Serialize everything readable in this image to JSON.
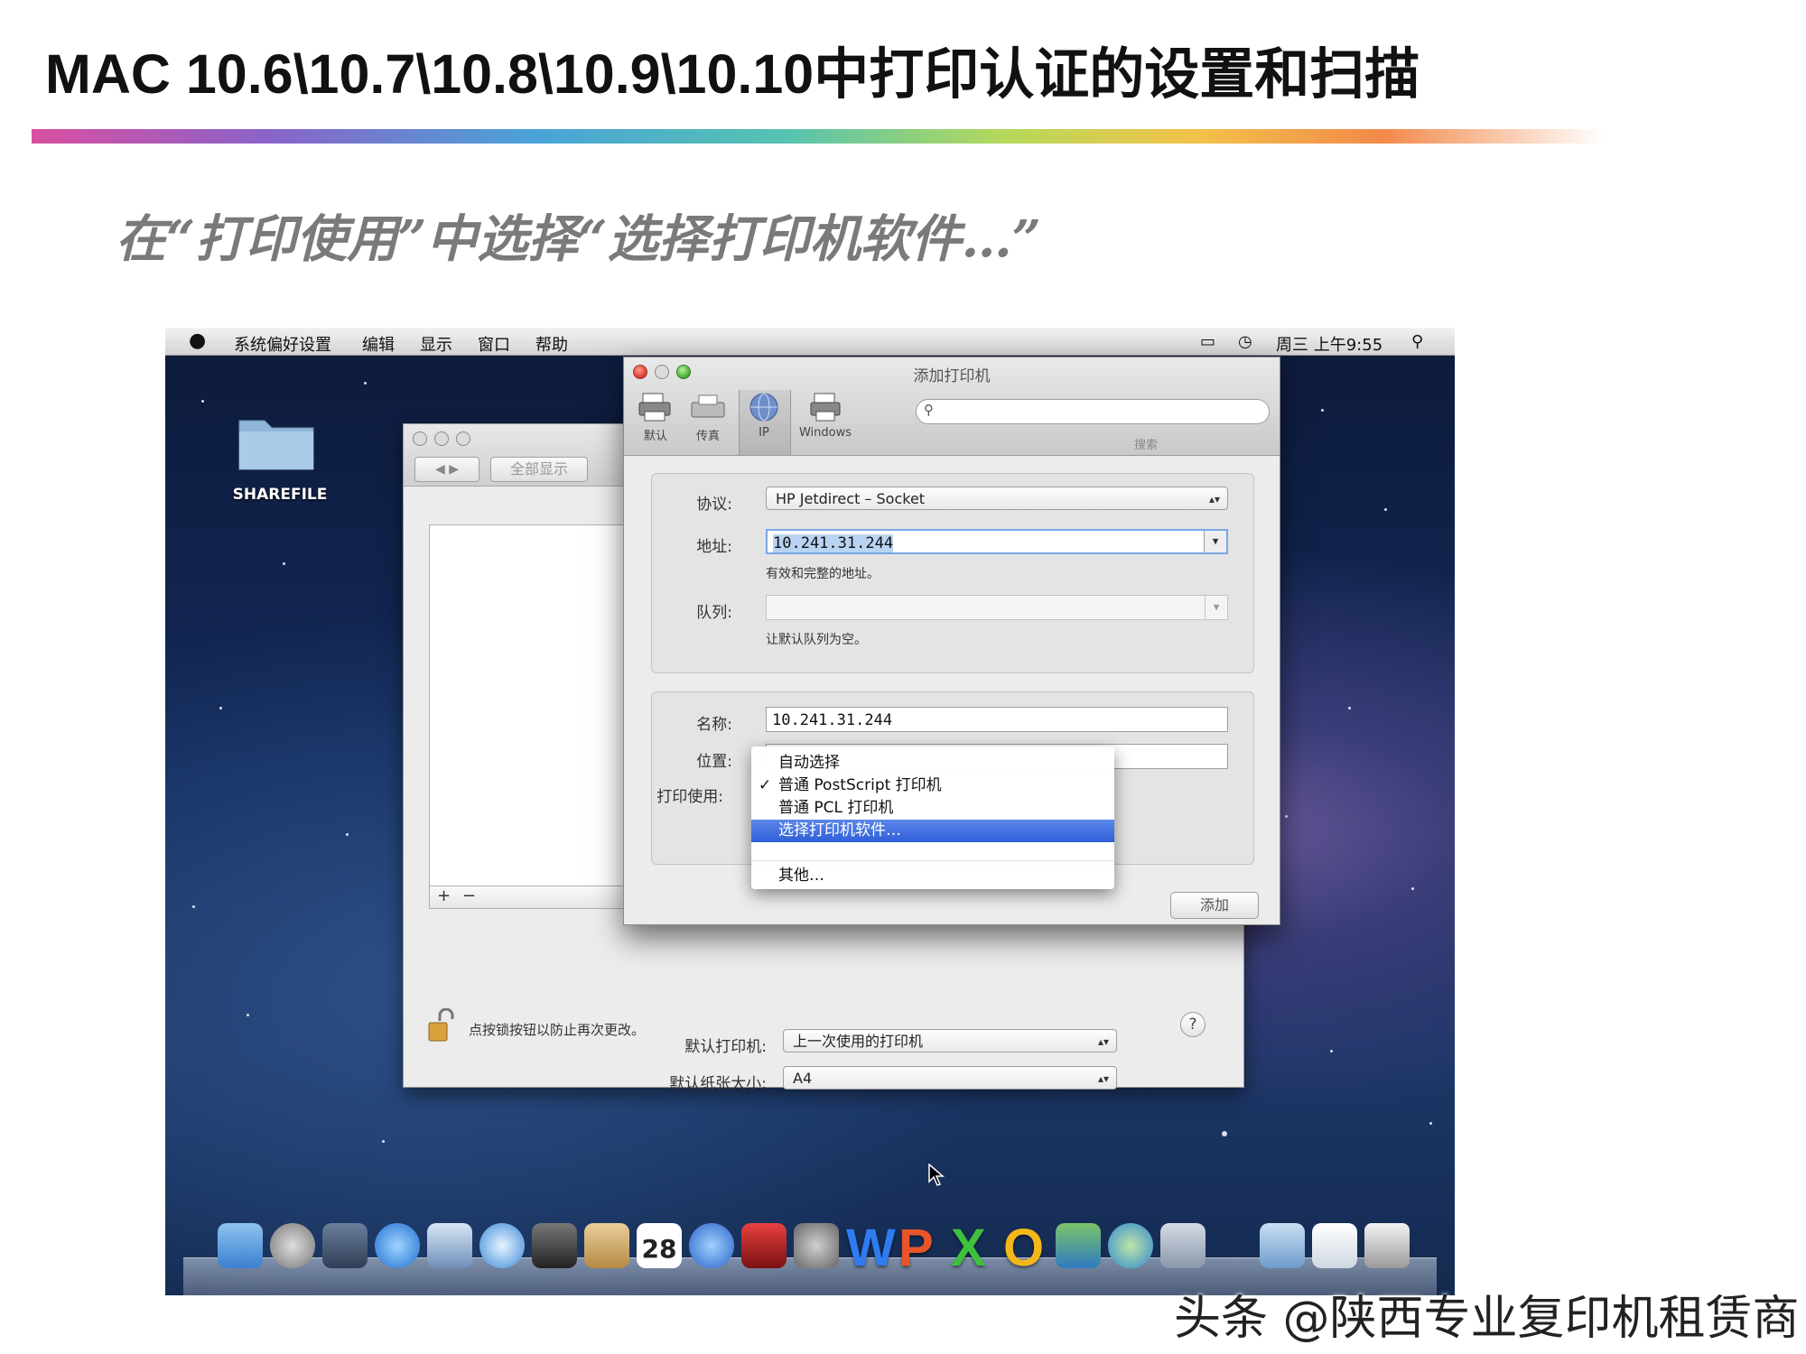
{
  "slide": {
    "title": "MAC 10.6\\10.7\\10.8\\10.9\\10.10中打印认证的设置和扫描",
    "subtitle": "在“打印使用”中选择“选择打印机软件…”"
  },
  "menubar": {
    "items": [
      "系统偏好设置",
      "编辑",
      "显示",
      "窗口",
      "帮助"
    ],
    "clock": "周三 上午9:55"
  },
  "desktop": {
    "folder_label": "SHAREFILE"
  },
  "prefs_window": {
    "show_all": "全部显示",
    "default_printer_label": "默认打印机:",
    "default_printer_value": "上一次使用的打印机",
    "default_paper_label": "默认纸张大小:",
    "default_paper_value": "A4",
    "lock_text": "点按锁按钮以防止再次更改。",
    "help": "?"
  },
  "add_printer_dialog": {
    "title": "添加打印机",
    "toolbar": [
      "默认",
      "传真",
      "IP",
      "Windows"
    ],
    "search_label": "搜索",
    "protocol_label": "协议:",
    "protocol_value": "HP Jetdirect – Socket",
    "address_label": "地址:",
    "address_value": "10.241.31.244",
    "address_hint": "有效和完整的地址。",
    "queue_label": "队列:",
    "queue_value": "",
    "queue_hint": "让默认队列为空。",
    "name_label": "名称:",
    "name_value": "10.241.31.244",
    "location_label": "位置:",
    "use_label": "打印使用:",
    "use_menu": {
      "options": [
        "自动选择",
        "普通 PostScript 打印机",
        "普通 PCL 打印机",
        "选择打印机软件…",
        "其他…"
      ],
      "checked_index": 1,
      "highlighted_index": 3,
      "check_mark": "✓"
    },
    "add_button": "添加"
  },
  "dock": {
    "calendar_day": "28"
  },
  "watermark": "头条 @陕西专业复印机租赁商"
}
